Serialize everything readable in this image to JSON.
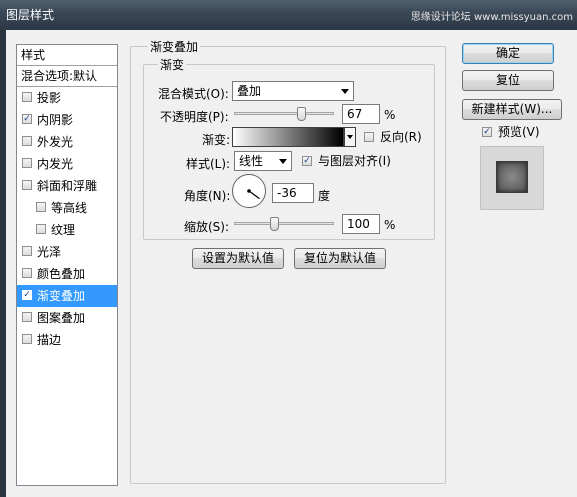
{
  "window": {
    "title": "图层样式",
    "watermark": "思缘设计论坛 www.missyuan.com"
  },
  "style_list": {
    "header": "样式",
    "blend_options": "混合选项:默认",
    "items": [
      {
        "label": "投影",
        "checked": false,
        "selected": false,
        "indent": false
      },
      {
        "label": "内阴影",
        "checked": true,
        "selected": false,
        "indent": false
      },
      {
        "label": "外发光",
        "checked": false,
        "selected": false,
        "indent": false
      },
      {
        "label": "内发光",
        "checked": false,
        "selected": false,
        "indent": false
      },
      {
        "label": "斜面和浮雕",
        "checked": false,
        "selected": false,
        "indent": false
      },
      {
        "label": "等高线",
        "checked": false,
        "selected": false,
        "indent": true
      },
      {
        "label": "纹理",
        "checked": false,
        "selected": false,
        "indent": true
      },
      {
        "label": "光泽",
        "checked": false,
        "selected": false,
        "indent": false
      },
      {
        "label": "颜色叠加",
        "checked": false,
        "selected": false,
        "indent": false
      },
      {
        "label": "渐变叠加",
        "checked": true,
        "selected": true,
        "indent": false
      },
      {
        "label": "图案叠加",
        "checked": false,
        "selected": false,
        "indent": false
      },
      {
        "label": "描边",
        "checked": false,
        "selected": false,
        "indent": false
      }
    ]
  },
  "gradient_overlay": {
    "section_title": "渐变叠加",
    "group_title": "渐变",
    "blend_mode_label": "混合模式(O):",
    "blend_mode_value": "叠加",
    "opacity_label": "不透明度(P):",
    "opacity_value": "67",
    "opacity_unit": "%",
    "opacity_fraction": 0.67,
    "gradient_label": "渐变:",
    "gradient_colors": [
      "#ffffff",
      "#000000"
    ],
    "reverse_label": "反向(R)",
    "reverse_checked": false,
    "style_label": "样式(L):",
    "style_value": "线性",
    "align_label": "与图层对齐(I)",
    "align_checked": true,
    "angle_label": "角度(N):",
    "angle_value": "-36",
    "angle_unit": "度",
    "scale_label": "缩放(S):",
    "scale_value": "100",
    "scale_unit": "%",
    "scale_fraction": 0.4,
    "set_default_label": "设置为默认值",
    "reset_default_label": "复位为默认值"
  },
  "buttons": {
    "ok": "确定",
    "reset": "复位",
    "new_style": "新建样式(W)...",
    "preview_label": "预览(V)",
    "preview_checked": true
  },
  "colors": {
    "selection": "#3399ff",
    "dialog_bg": "#f0f0f0"
  }
}
